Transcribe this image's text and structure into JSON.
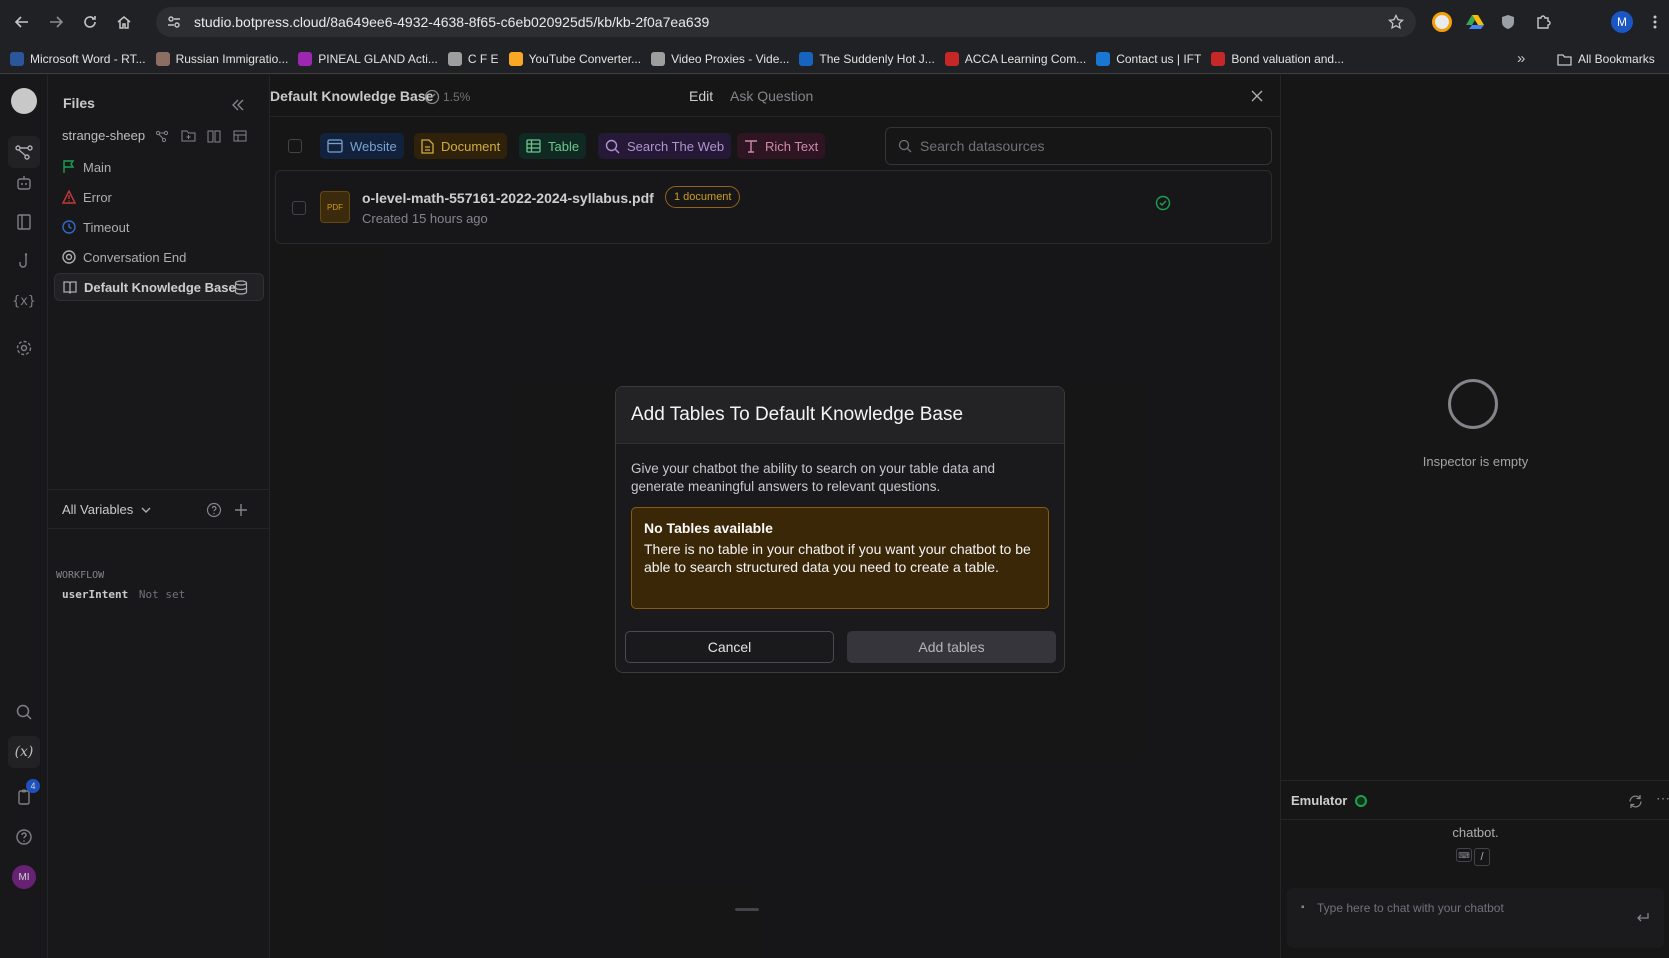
{
  "browser": {
    "url": "studio.botpress.cloud/8a649ee6-4932-4638-8f65-c6eb020925d5/kb/kb-2f0a7ea639",
    "profile_initial": "M",
    "bookmarks": [
      {
        "label": "Microsoft Word - RT...",
        "color": "#2b579a"
      },
      {
        "label": "Russian Immigratio...",
        "color": "#8d6e63"
      },
      {
        "label": "PINEAL GLAND Acti...",
        "color": "#9c27b0"
      },
      {
        "label": "C F E",
        "color": "#9e9e9e"
      },
      {
        "label": "YouTube Converter...",
        "color": "#f9a825"
      },
      {
        "label": "Video Proxies - Vide...",
        "color": "#9e9e9e"
      },
      {
        "label": "The Suddenly Hot J...",
        "color": "#1565c0"
      },
      {
        "label": "ACCA Learning Com...",
        "color": "#c62828"
      },
      {
        "label": "Contact us | IFT",
        "color": "#1976d2"
      },
      {
        "label": "Bond valuation and...",
        "color": "#c62828"
      }
    ],
    "all_bookmarks": "All Bookmarks",
    "more_chevron": "»"
  },
  "rail": {
    "notification_count": "4",
    "avatar_initials": "MI"
  },
  "files": {
    "title": "Files",
    "bot_name": "strange-sheep",
    "items": [
      {
        "label": "Main",
        "icon": "flag-icon",
        "color": "#22c55e"
      },
      {
        "label": "Error",
        "icon": "warning-icon",
        "color": "#ef4444"
      },
      {
        "label": "Timeout",
        "icon": "clock-icon",
        "color": "#3b82f6"
      },
      {
        "label": "Conversation End",
        "icon": "target-icon",
        "color": "#d4d4d8"
      },
      {
        "label": "Default Knowledge Base",
        "icon": "book-icon",
        "color": "#d4d4d8",
        "active": true
      }
    ],
    "variables": {
      "title": "All Variables",
      "section": "WORKFLOW",
      "var_name": "userIntent",
      "var_value": "Not set"
    }
  },
  "kb": {
    "title": "Default Knowledge Base",
    "progress": "1.5%",
    "tab_edit": "Edit",
    "tab_ask": "Ask Question",
    "chips": [
      {
        "label": "Website",
        "bg": "#172a4a",
        "fg": "#93c5fd",
        "icon": "browser-icon"
      },
      {
        "label": "Document",
        "bg": "#3b2a0d",
        "fg": "#fcd34d",
        "icon": "document-icon"
      },
      {
        "label": "Table",
        "bg": "#14332a",
        "fg": "#86efac",
        "icon": "table-icon"
      },
      {
        "label": "Search The Web",
        "bg": "#2e1f44",
        "fg": "#d8b4fe",
        "icon": "search-icon"
      },
      {
        "label": "Rich Text",
        "bg": "#3a1a2a",
        "fg": "#f9a8d4",
        "icon": "text-icon"
      }
    ],
    "search_placeholder": "Search datasources",
    "document": {
      "name": "o-level-math-557161-2022-2024-syllabus.pdf",
      "badge": "1 document",
      "created": "Created 15 hours ago",
      "icon_label": "PDF"
    }
  },
  "inspector": {
    "empty_text": "Inspector is empty"
  },
  "emulator": {
    "title": "Emulator",
    "partial_text": "chatbot.",
    "key_hint": "/",
    "chat_placeholder": "Type here to chat with your chatbot"
  },
  "modal": {
    "title": "Add Tables To Default Knowledge Base",
    "description": "Give your chatbot the ability to search on your table data and generate meaningful answers to relevant questions.",
    "warning_title": "No Tables available",
    "warning_body": "There is no table in your chatbot if you want your chatbot to be able to search structured data you need to create a table.",
    "cancel": "Cancel",
    "confirm": "Add tables"
  },
  "colors": {
    "accent_green": "#22c55e",
    "warning_bg": "#3a2708",
    "warning_border": "#8a5a12"
  }
}
